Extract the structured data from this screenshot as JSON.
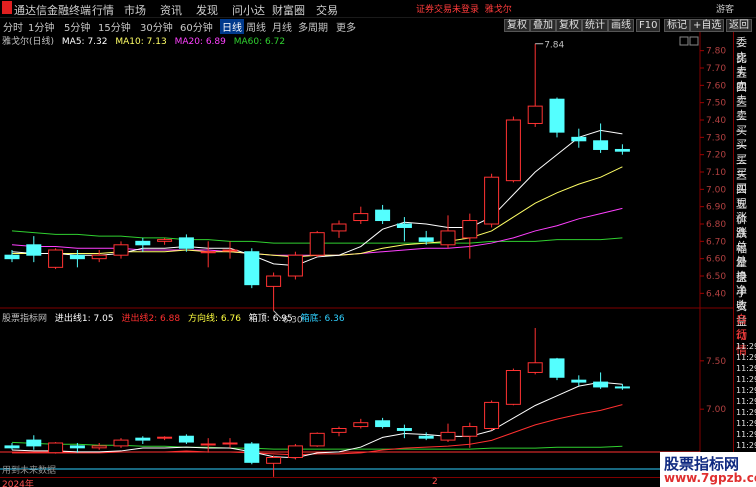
{
  "titlebar": {
    "app_name": "通达信金融终端",
    "menus": [
      "行情",
      "市场",
      "资讯",
      "发现",
      "问小达",
      "财富圈",
      "交易"
    ],
    "warning": "证券交易未登录",
    "stock": "雅戈尔",
    "guest": "游客"
  },
  "toolbar": {
    "periods": [
      "分时",
      "1分钟",
      "5分钟",
      "15分钟",
      "30分钟",
      "60分钟",
      "日线",
      "周线",
      "月线",
      "多周期",
      "更多"
    ],
    "active_period": "日线",
    "right_buttons": [
      "叠加",
      "复权",
      "统计",
      "画线",
      "F10",
      "标记",
      "+自选",
      "返回"
    ],
    "first_right_button": "复权"
  },
  "main_legend": {
    "name": "雅戈尔(日线)",
    "items": [
      {
        "label": "MA5: 7.32",
        "color": "#ffffff"
      },
      {
        "label": "MA10: 7.13",
        "color": "#ffff66"
      },
      {
        "label": "MA20: 6.89",
        "color": "#ff40ff"
      },
      {
        "label": "MA60: 6.72",
        "color": "#30d030"
      }
    ]
  },
  "sub_legend": {
    "name": "股票指标网",
    "items": [
      {
        "label": "进出线1: 7.05",
        "color": "#ffffff"
      },
      {
        "label": "进出线2: 6.88",
        "color": "#ff3030"
      },
      {
        "label": "方向线: 6.76",
        "color": "#ffff40"
      },
      {
        "label": "箱顶: 6.95",
        "color": "#ffffff"
      },
      {
        "label": "箱底: 6.36",
        "color": "#30d0ff"
      }
    ]
  },
  "main_axis": [
    "7.80",
    "7.70",
    "7.60",
    "7.50",
    "7.40",
    "7.30",
    "7.20",
    "7.10",
    "7.00",
    "6.90",
    "6.80",
    "6.70",
    "6.60",
    "6.50",
    "6.40"
  ],
  "sub_axis": [
    "7.50",
    "7.00"
  ],
  "annotations": {
    "high": "7.84",
    "low": "6.30"
  },
  "right_panel": [
    "委比",
    "卖五",
    "卖四",
    "卖三",
    "卖二",
    "卖一",
    "买一",
    "买二",
    "买三",
    "买四",
    "买五",
    "现价",
    "涨跌",
    "涨幅",
    "总量",
    "外盘",
    "换手",
    "净资",
    "收益",
    "自动",
    "行情"
  ],
  "right_times": [
    "11:29",
    "11:29",
    "11:29",
    "11:29",
    "11:29",
    "11:29",
    "11:29",
    "11:29",
    "11:29",
    "11:29",
    "11:29",
    "11:29",
    "11:29"
  ],
  "footer": {
    "year": "2024年",
    "marker": "2"
  },
  "sub_note": "用到未来数据",
  "watermark": {
    "line1": "股票指标网",
    "line2": "www.7gpzb.com"
  },
  "chart_data": {
    "type": "candlestick",
    "title": "雅戈尔(日线)",
    "ylim": [
      6.35,
      7.85
    ],
    "candles": [
      {
        "o": 6.62,
        "c": 6.6,
        "h": 6.65,
        "l": 6.58
      },
      {
        "o": 6.68,
        "c": 6.62,
        "h": 6.73,
        "l": 6.58
      },
      {
        "o": 6.55,
        "c": 6.65,
        "h": 6.66,
        "l": 6.54
      },
      {
        "o": 6.62,
        "c": 6.6,
        "h": 6.65,
        "l": 6.55
      },
      {
        "o": 6.6,
        "c": 6.62,
        "h": 6.65,
        "l": 6.58
      },
      {
        "o": 6.62,
        "c": 6.68,
        "h": 6.7,
        "l": 6.6
      },
      {
        "o": 6.7,
        "c": 6.68,
        "h": 6.72,
        "l": 6.64
      },
      {
        "o": 6.7,
        "c": 6.71,
        "h": 6.72,
        "l": 6.68
      },
      {
        "o": 6.72,
        "c": 6.66,
        "h": 6.74,
        "l": 6.64
      },
      {
        "o": 6.64,
        "c": 6.64,
        "h": 6.7,
        "l": 6.55
      },
      {
        "o": 6.65,
        "c": 6.65,
        "h": 6.7,
        "l": 6.6
      },
      {
        "o": 6.64,
        "c": 6.45,
        "h": 6.66,
        "l": 6.43
      },
      {
        "o": 6.44,
        "c": 6.5,
        "h": 6.52,
        "l": 6.3
      },
      {
        "o": 6.5,
        "c": 6.62,
        "h": 6.64,
        "l": 6.48
      },
      {
        "o": 6.62,
        "c": 6.75,
        "h": 6.76,
        "l": 6.61
      },
      {
        "o": 6.76,
        "c": 6.8,
        "h": 6.82,
        "l": 6.72
      },
      {
        "o": 6.82,
        "c": 6.86,
        "h": 6.9,
        "l": 6.8
      },
      {
        "o": 6.88,
        "c": 6.82,
        "h": 6.91,
        "l": 6.8
      },
      {
        "o": 6.8,
        "c": 6.78,
        "h": 6.84,
        "l": 6.7
      },
      {
        "o": 6.72,
        "c": 6.7,
        "h": 6.76,
        "l": 6.68
      },
      {
        "o": 6.68,
        "c": 6.76,
        "h": 6.85,
        "l": 6.66
      },
      {
        "o": 6.72,
        "c": 6.82,
        "h": 6.86,
        "l": 6.6
      },
      {
        "o": 6.8,
        "c": 7.07,
        "h": 7.09,
        "l": 6.78
      },
      {
        "o": 7.05,
        "c": 7.4,
        "h": 7.42,
        "l": 7.04
      },
      {
        "o": 7.38,
        "c": 7.48,
        "h": 7.84,
        "l": 7.36
      },
      {
        "o": 7.52,
        "c": 7.33,
        "h": 7.53,
        "l": 7.3
      },
      {
        "o": 7.3,
        "c": 7.28,
        "h": 7.35,
        "l": 7.24
      },
      {
        "o": 7.28,
        "c": 7.23,
        "h": 7.38,
        "l": 7.21
      },
      {
        "o": 7.23,
        "c": 7.22,
        "h": 7.26,
        "l": 7.2
      }
    ],
    "ma5": [
      6.64,
      6.63,
      6.63,
      6.62,
      6.62,
      6.63,
      6.66,
      6.66,
      6.67,
      6.66,
      6.66,
      6.62,
      6.57,
      6.56,
      6.61,
      6.62,
      6.67,
      6.77,
      6.81,
      6.8,
      6.78,
      6.78,
      6.84,
      6.97,
      7.1,
      7.2,
      7.3,
      7.34,
      7.32
    ],
    "ma10": [
      6.63,
      6.63,
      6.63,
      6.63,
      6.63,
      6.64,
      6.64,
      6.64,
      6.65,
      6.64,
      6.64,
      6.63,
      6.62,
      6.61,
      6.62,
      6.62,
      6.63,
      6.66,
      6.68,
      6.69,
      6.7,
      6.72,
      6.76,
      6.84,
      6.92,
      6.98,
      7.03,
      7.07,
      7.13
    ],
    "ma20": [
      6.68,
      6.67,
      6.67,
      6.66,
      6.66,
      6.66,
      6.65,
      6.65,
      6.65,
      6.65,
      6.64,
      6.63,
      6.62,
      6.62,
      6.62,
      6.62,
      6.63,
      6.64,
      6.65,
      6.66,
      6.66,
      6.67,
      6.69,
      6.72,
      6.76,
      6.79,
      6.83,
      6.86,
      6.89
    ],
    "ma60": [
      6.76,
      6.75,
      6.74,
      6.74,
      6.73,
      6.73,
      6.72,
      6.72,
      6.71,
      6.71,
      6.7,
      6.7,
      6.69,
      6.69,
      6.69,
      6.69,
      6.69,
      6.69,
      6.69,
      6.69,
      6.69,
      6.69,
      6.7,
      6.7,
      6.7,
      6.71,
      6.71,
      6.71,
      6.72
    ]
  }
}
